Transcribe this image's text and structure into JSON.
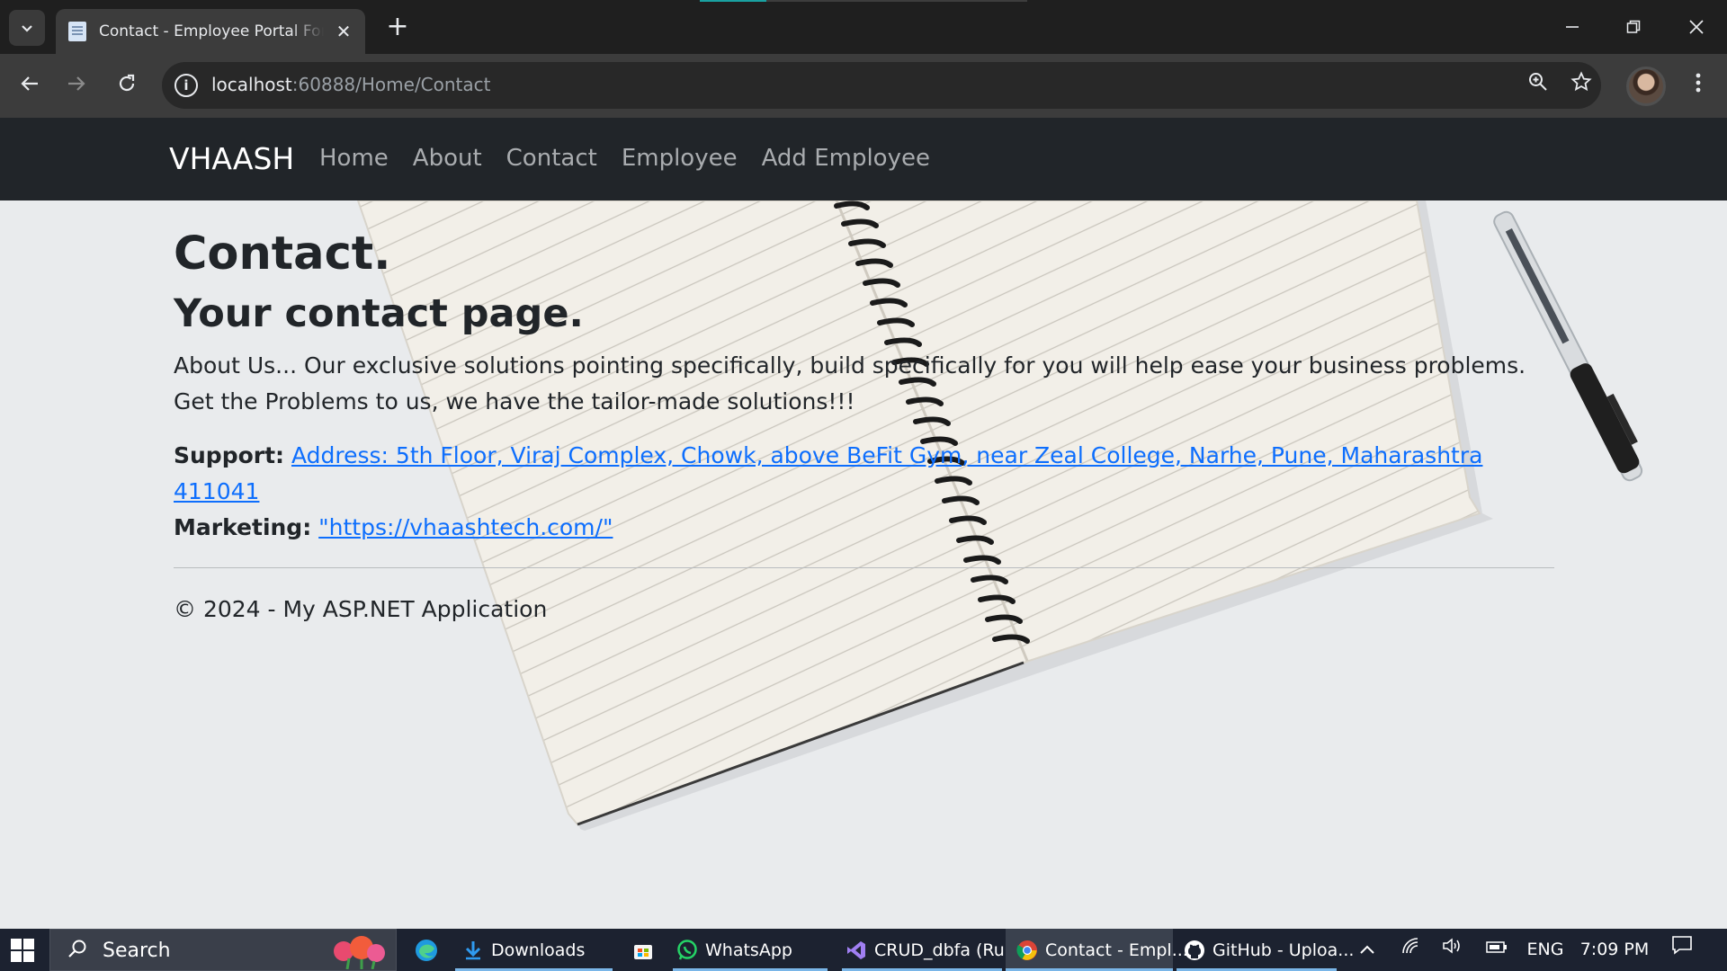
{
  "browser": {
    "tab_title": "Contact - Employee Portal For (",
    "tab_close": "✕",
    "new_tab": "+",
    "url_host": "localhost",
    "url_rest": ":60888/Home/Contact",
    "icons": [
      "tab-search-icon",
      "back-icon",
      "forward-icon",
      "reload-icon",
      "site-info-icon",
      "zoom-icon",
      "bookmark-star-icon",
      "profile-avatar",
      "menu-dots-icon",
      "minimize-icon",
      "restore-icon",
      "close-icon"
    ]
  },
  "site": {
    "brand": "VHAASH",
    "nav": [
      "Home",
      "About",
      "Contact",
      "Employee",
      "Add Employee"
    ],
    "title": "Contact.",
    "subtitle": "Your contact page.",
    "about": "About Us... Our exclusive solutions pointing specifically, build specifically for you will help ease your business problems. Get the Problems to us, we have the tailor-made solutions!!!",
    "support_label": "Support:",
    "support_link": "Address: 5th Floor, Viraj Complex, Chowk, above BeFit Gym, near Zeal College, Narhe, Pune, Maharashtra 411041",
    "marketing_label": "Marketing:",
    "marketing_link": "\"https://vhaashtech.com/\"",
    "footer": "© 2024 - My ASP.NET Application"
  },
  "taskbar": {
    "search": "Search",
    "items": [
      "Downloads",
      "WhatsApp",
      "CRUD_dbfa (Ru...",
      "Contact - Empl...",
      "GitHub - Uploa..."
    ],
    "lang": "ENG",
    "time": "7:09 PM",
    "colors": {
      "accent": "#0d6efd",
      "navbar": "#212529",
      "taskbar": "#1c2230"
    }
  }
}
